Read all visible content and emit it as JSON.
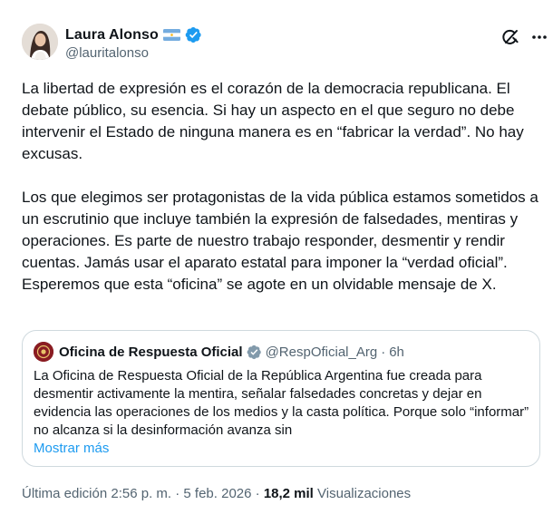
{
  "author": {
    "display_name": "Laura Alonso",
    "handle": "@lauritalonso",
    "flag_icon": "argentina-flag-icon",
    "verified_icon": "verified-badge-icon"
  },
  "actions": {
    "grok_icon": "grok-icon",
    "more_icon": "more-options-icon"
  },
  "tweet": {
    "paragraphs": [
      "La libertad de expresión es el corazón de la democracia republicana. El debate público, su esencia. Si hay un aspecto en el que seguro no debe intervenir el Estado de ninguna manera es en “fabricar la verdad”. No hay excusas.",
      "Los que elegimos ser protagonistas de la vida pública estamos sometidos a un escrutinio que incluye también la expresión de falsedades, mentiras y operaciones. Es parte de nuestro trabajo responder, desmentir y rendir cuentas. Jamás usar el aparato estatal para imponer la “verdad oficial”. Esperemos que esta “oficina” se agote en un olvidable mensaje de X."
    ]
  },
  "quote": {
    "display_name": "Oficina de Respuesta Oficial",
    "handle": "@RespOficial_Arg",
    "separator": "·",
    "time": "6h",
    "text": "La Oficina de Respuesta Oficial de la República Argentina fue creada para desmentir activamente la mentira, señalar falsedades concretas y dejar en evidencia las operaciones de los medios y la casta política. Porque solo “informar” no alcanza si la desinformación avanza sin",
    "show_more": "Mostrar más",
    "verified_icon": "gray-verified-badge-icon"
  },
  "meta": {
    "edited": "Última edición 2:56 p. m. · 5 feb. 2026 ·",
    "views_count": "18,2 mil",
    "views_label": "Visualizaciones"
  },
  "colors": {
    "text": "#0f1419",
    "secondary": "#536471",
    "link": "#1d9bf0",
    "border": "#cfd9de",
    "verified_blue": "#1d9bf0",
    "verified_gray": "#829aab",
    "quote_avatar": "#8a1c22"
  }
}
